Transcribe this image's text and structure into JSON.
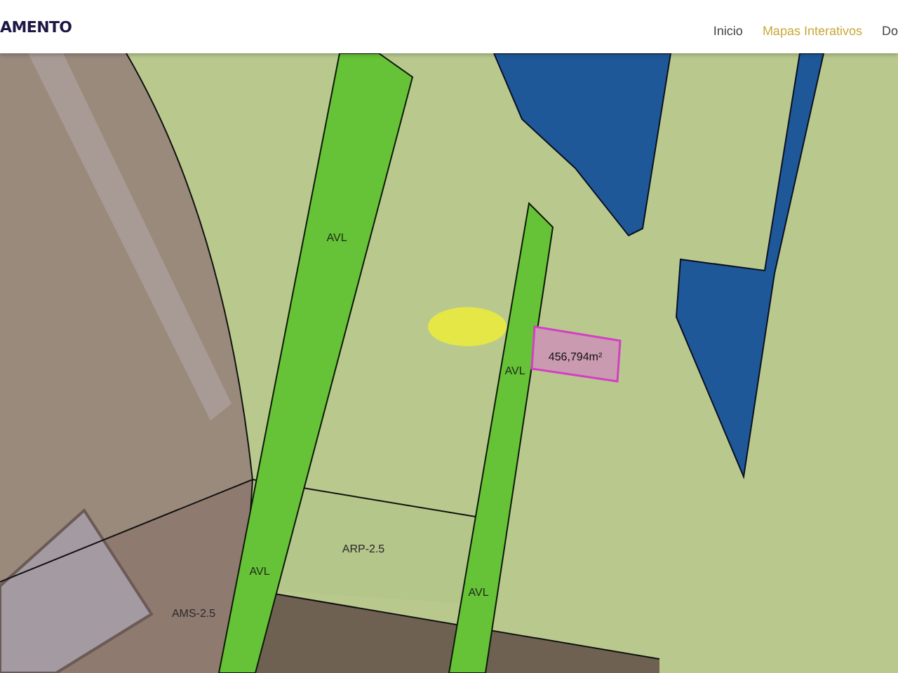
{
  "header": {
    "logo": "AMENTO",
    "nav": [
      {
        "label": "Inicio",
        "selected": false
      },
      {
        "label": "Mapas Interativos",
        "selected": true
      },
      {
        "label": "Do",
        "selected": false
      }
    ]
  },
  "map": {
    "zone_labels": [
      {
        "text": "AVL",
        "kind": "strip"
      },
      {
        "text": "AVL",
        "kind": "strip"
      },
      {
        "text": "ARP-2.5",
        "kind": "zone"
      },
      {
        "text": "AVL",
        "kind": "strip"
      },
      {
        "text": "AMS-2.5",
        "kind": "zone"
      },
      {
        "text": "AVL",
        "kind": "strip"
      }
    ],
    "measurement": {
      "text": "456,794m²"
    }
  }
}
